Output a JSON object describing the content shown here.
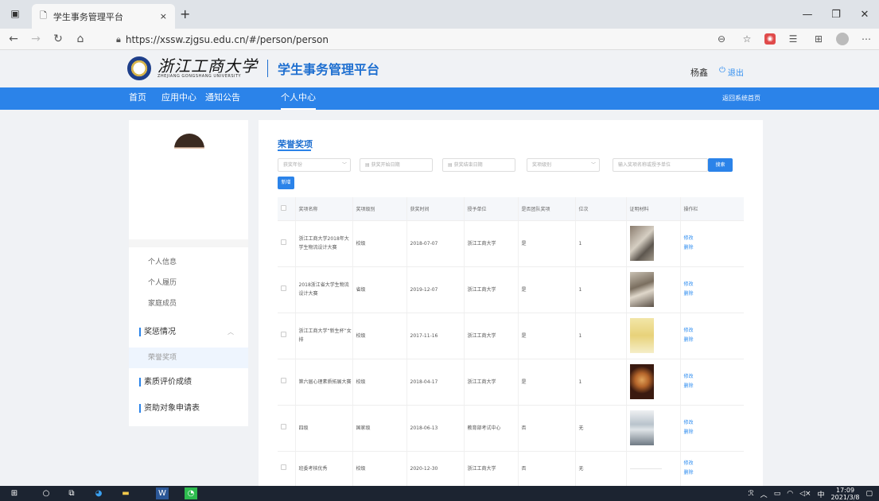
{
  "browser": {
    "tab_title": "学生事务管理平台",
    "tab_close": "×",
    "new_tab": "+",
    "url": "https://xssw.zjgsu.edu.cn/#/person/person"
  },
  "header": {
    "school_name": "浙江工商大学",
    "school_name_en": "ZHEJIANG GONGSHANG UNIVERSITY",
    "platform_title": "学生事务管理平台",
    "username": "杨鑫",
    "logout_label": "退出"
  },
  "nav": {
    "items": [
      "首页",
      "应用中心",
      "通知公告",
      "个人中心"
    ],
    "back_home": "返回系统首页"
  },
  "sidebar": {
    "items": [
      {
        "label": "个人信息"
      },
      {
        "label": "个人履历"
      },
      {
        "label": "家庭成员"
      },
      {
        "label": "奖惩情况"
      },
      {
        "label": "荣誉奖项"
      },
      {
        "label": "素质评价成绩"
      },
      {
        "label": "资助对象申请表"
      }
    ]
  },
  "main": {
    "section_title": "荣誉奖项",
    "filters": {
      "year": "获奖年份",
      "start_date": "获奖开始日期",
      "end_date": "获奖结束日期",
      "level": "奖项级别",
      "keyword": "输入奖项名称或授予单位",
      "search_label": "搜索",
      "add_label": "新增"
    },
    "table": {
      "headers": [
        "奖项名称",
        "奖项级别",
        "获奖时间",
        "授予单位",
        "是否团队奖项",
        "位次",
        "证明材料",
        "操作栏"
      ],
      "edit_label": "修改",
      "delete_label": "删除",
      "rows": [
        {
          "name": "浙江工商大学2018年大学生物流设计大赛",
          "level": "校级",
          "date": "2018-07-07",
          "org": "浙江工商大学",
          "team": "是",
          "rank": "1"
        },
        {
          "name": "2018浙江省大学生物流设计大赛",
          "level": "省级",
          "date": "2019-12-07",
          "org": "浙江工商大学",
          "team": "是",
          "rank": "1"
        },
        {
          "name": "浙江工商大学“新生杯”女排",
          "level": "校级",
          "date": "2017-11-16",
          "org": "浙江工商大学",
          "team": "是",
          "rank": "1"
        },
        {
          "name": "第六届心理素质拓展大赛",
          "level": "校级",
          "date": "2018-04-17",
          "org": "浙江工商大学",
          "team": "是",
          "rank": "1"
        },
        {
          "name": "四级",
          "level": "国家级",
          "date": "2018-06-13",
          "org": "教育部考试中心",
          "team": "否",
          "rank": "无"
        },
        {
          "name": "班委考核优秀",
          "level": "校级",
          "date": "2020-12-30",
          "org": "浙江工商大学",
          "team": "否",
          "rank": "无"
        }
      ]
    }
  },
  "taskbar": {
    "time": "17:09",
    "date": "2021/3/8",
    "ime": "中"
  }
}
